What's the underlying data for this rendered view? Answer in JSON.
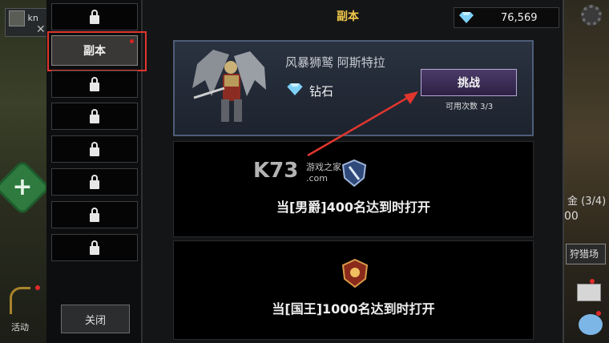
{
  "header": {
    "title": "副本",
    "currency_value": "76,569"
  },
  "left_hud": {
    "player_name_fragment": "kn",
    "activity_label": "活动"
  },
  "right_hud": {
    "fragment_1": "金 (3/4)",
    "fragment_2": "00",
    "fragment_3": "狩猎场"
  },
  "sidebar": {
    "active_label": "副本",
    "close_label": "关闭"
  },
  "active_dungeon": {
    "boss_name": "风暴狮鹫 阿斯特拉",
    "reward_label": "钻石",
    "challenge_label": "挑战",
    "uses_label": "可用次数 3/3"
  },
  "locked_dungeons": [
    {
      "requirement": "当[男爵]400名达到时打开"
    },
    {
      "requirement": "当[国王]1000名达到时打开"
    }
  ],
  "watermark": {
    "brand": "K73",
    "tagline": "游戏之家",
    "domain": ".com"
  },
  "colors": {
    "title_gold": "#f2c84b",
    "highlight_red": "#e0362e",
    "challenge_purple": "#4a3a68",
    "active_card_border": "#4e5d78"
  }
}
